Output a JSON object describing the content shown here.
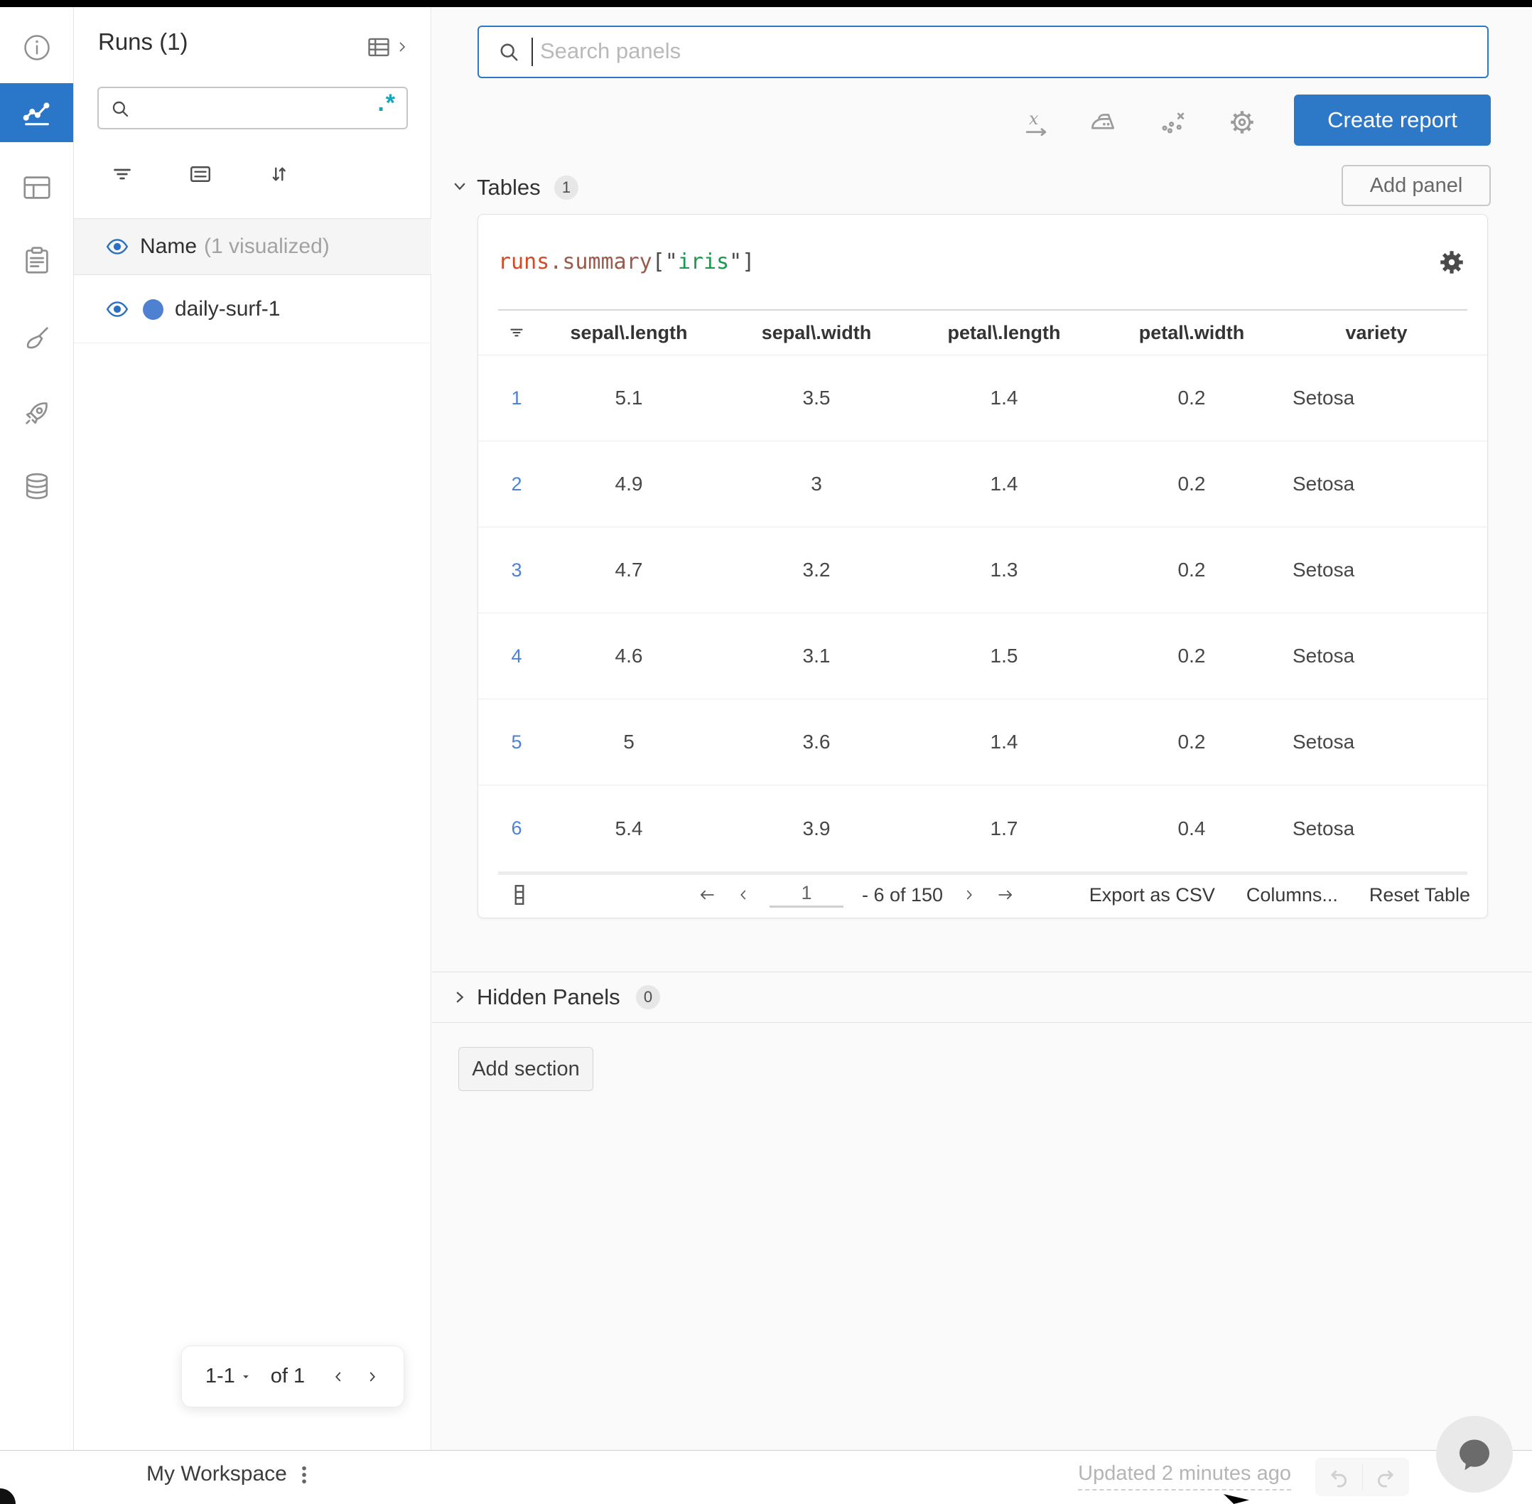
{
  "sidebar": {
    "title": "Runs (1)",
    "search_placeholder": "",
    "regex_label": ".*",
    "columns_header": {
      "name": "Name",
      "visualized": "(1 visualized)"
    },
    "runs": [
      {
        "name": "daily-surf-1",
        "dot_color": "#4e81d2"
      }
    ],
    "pagination": {
      "range": "1-1",
      "of": "of 1"
    }
  },
  "toolbar": {
    "search_placeholder": "Search panels",
    "create_report": "Create report"
  },
  "sections": {
    "tables": {
      "label": "Tables",
      "count": "1"
    },
    "hidden_panels": {
      "label": "Hidden Panels",
      "count": "0"
    },
    "add_panel": "Add panel",
    "add_section": "Add section"
  },
  "panel": {
    "code_parts": [
      {
        "text": "runs",
        "color": "#d24b26"
      },
      {
        "text": ".",
        "color": "#9a5a4c"
      },
      {
        "text": "summary",
        "color": "#9a5a4c"
      },
      {
        "text": "[\"",
        "color": "#4b4b4b"
      },
      {
        "text": "iris",
        "color": "#199a4d"
      },
      {
        "text": "\"]",
        "color": "#4b4b4b"
      }
    ],
    "table": {
      "columns": [
        "sepal\\.length",
        "sepal\\.width",
        "petal\\.length",
        "petal\\.width",
        "variety"
      ],
      "rows": [
        {
          "index": "1",
          "values": [
            "5.1",
            "3.5",
            "1.4",
            "0.2",
            "Setosa"
          ]
        },
        {
          "index": "2",
          "values": [
            "4.9",
            "3",
            "1.4",
            "0.2",
            "Setosa"
          ]
        },
        {
          "index": "3",
          "values": [
            "4.7",
            "3.2",
            "1.3",
            "0.2",
            "Setosa"
          ]
        },
        {
          "index": "4",
          "values": [
            "4.6",
            "3.1",
            "1.5",
            "0.2",
            "Setosa"
          ]
        },
        {
          "index": "5",
          "values": [
            "5",
            "3.6",
            "1.4",
            "0.2",
            "Setosa"
          ]
        },
        {
          "index": "6",
          "values": [
            "5.4",
            "3.9",
            "1.7",
            "0.4",
            "Setosa"
          ]
        }
      ],
      "footer": {
        "page": "1",
        "range": "- 6 of 150",
        "export_csv": "Export as CSV",
        "columns": "Columns...",
        "reset": "Reset Table"
      }
    }
  },
  "statusbar": {
    "workspace": "My Workspace",
    "updated": "Updated 2 minutes ago"
  },
  "colors": {
    "accent_blue": "#2d78c7",
    "rail_active_blue": "#2a76c8",
    "run_dot": "#4e81d2",
    "row_index_blue": "#4d82d6",
    "regex_teal": "#14a5b8"
  }
}
